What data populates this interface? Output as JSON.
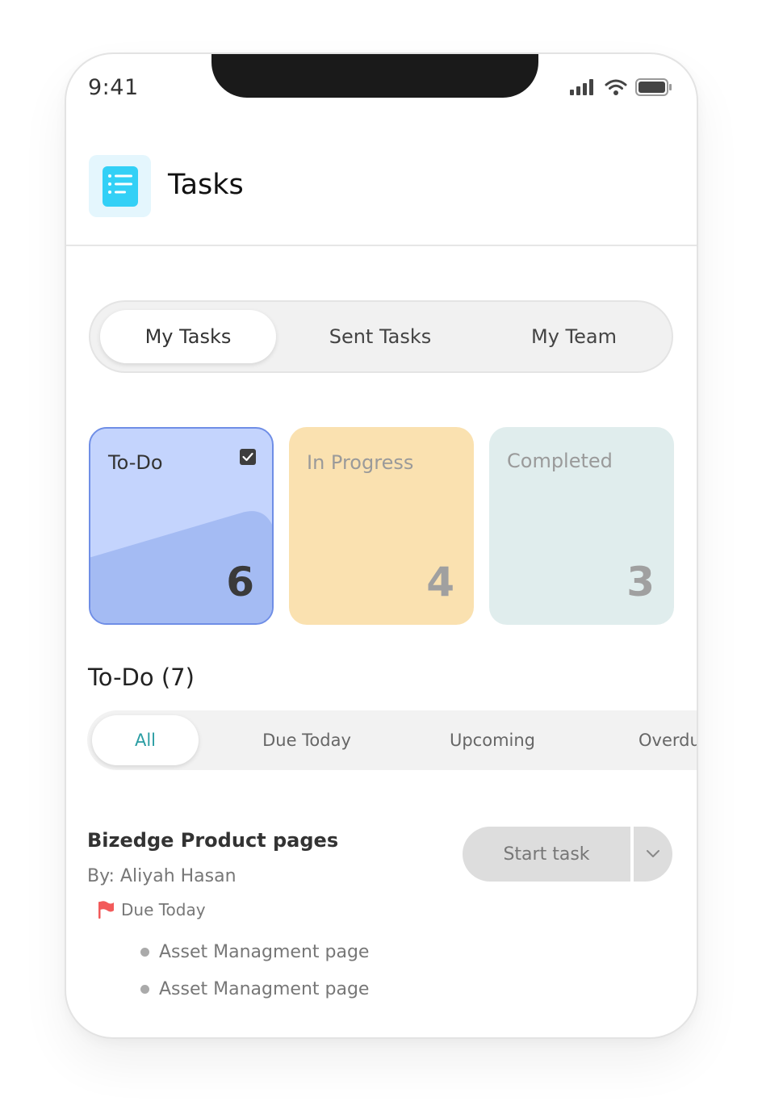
{
  "status_bar": {
    "time": "9:41"
  },
  "header": {
    "title": "Tasks",
    "icon": "task-list-icon"
  },
  "tabs": [
    {
      "label": "My Tasks",
      "active": true
    },
    {
      "label": "Sent Tasks",
      "active": false
    },
    {
      "label": "My Team",
      "active": false
    }
  ],
  "cards": [
    {
      "label": "To-Do",
      "count": "6",
      "color": "#c4d4fd",
      "selected": true
    },
    {
      "label": "In Progress",
      "count": "4",
      "color": "#fae1b0",
      "selected": false
    },
    {
      "label": "Completed",
      "count": "3",
      "color": "#e0eded",
      "selected": false
    }
  ],
  "section": {
    "title": "To-Do (7)"
  },
  "filters": [
    {
      "label": "All",
      "active": true
    },
    {
      "label": "Due Today",
      "active": false
    },
    {
      "label": "Upcoming",
      "active": false
    },
    {
      "label": "Overdue",
      "active": false
    }
  ],
  "task": {
    "title": "Bizedge Product pages",
    "by": "By: Aliyah Hasan",
    "due": "Due Today",
    "subitems": [
      "Asset Managment page",
      "Asset Managment page"
    ],
    "start_label": "Start task"
  },
  "colors": {
    "accent": "#2a9da3",
    "flag": "#f25a5a",
    "todo_border": "#6f8ee6"
  }
}
